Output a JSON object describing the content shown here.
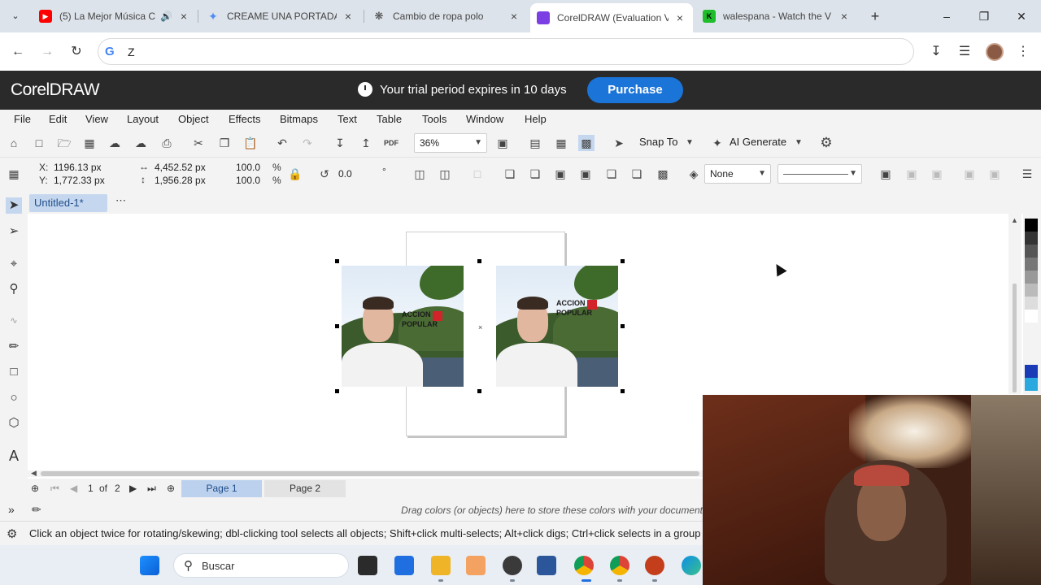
{
  "browser": {
    "tabs": [
      {
        "title": "(5) La Mejor Música C",
        "favicon": "youtube-icon",
        "color": "#ff0000",
        "audio": true
      },
      {
        "title": "CREAME UNA PORTADA",
        "favicon": "gemini-icon",
        "color": "#4f8df5",
        "audio": false
      },
      {
        "title": "Cambio de ropa polo",
        "favicon": "chatgpt-icon",
        "color": "#444444",
        "audio": false
      },
      {
        "title": "CorelDRAW (Evaluation V",
        "favicon": "coreldraw-icon",
        "color": "#7b3fe4",
        "audio": false,
        "active": true
      },
      {
        "title": "walespana - Watch the V",
        "favicon": "kick-icon",
        "color": "#1fbd2b",
        "audio": false
      }
    ],
    "address": "Z"
  },
  "corel": {
    "app_name": "CorelDRAW",
    "trial_text": "Your trial period expires in 10 days",
    "purchase_label": "Purchase",
    "menu": [
      "File",
      "Edit",
      "View",
      "Layout",
      "Object",
      "Effects",
      "Bitmaps",
      "Text",
      "Table",
      "Tools",
      "Window",
      "Help"
    ],
    "toolbar": {
      "zoom": "36%",
      "snap_to": "Snap To",
      "ai_generate": "AI Generate"
    },
    "props": {
      "x_label": "X:",
      "x_value": "1196.13 px",
      "y_label": "Y:",
      "y_value": "1,772.33 px",
      "width_value": "4,452.52 px",
      "height_value": "1,956.28 px",
      "scale_w": "100.0",
      "scale_h": "100.0",
      "pct": "%",
      "rotation": "0.0",
      "deg": "°",
      "outline": "None"
    },
    "document_tab": "Untitled-1*",
    "page_nav": {
      "current": "1",
      "of": "of",
      "total": "2",
      "pages": [
        "Page 1",
        "Page 2"
      ]
    },
    "logo_text_line1": "ACCION",
    "logo_text_line2": "POPULAR",
    "color_hint": "Drag colors (or objects) here to store these colors with your document",
    "status": "Click an object twice for rotating/skewing; dbl-clicking tool selects all objects; Shift+click multi-selects; Alt+click digs; Ctrl+click selects in a group"
  },
  "taskbar": {
    "search_label": "Buscar"
  },
  "palette_colors": [
    "#000000",
    "#333333",
    "#555555",
    "#777777",
    "#999999",
    "#bbbbbb",
    "#dddddd",
    "#ffffff",
    "#1a3bb5",
    "#29a9e0"
  ]
}
